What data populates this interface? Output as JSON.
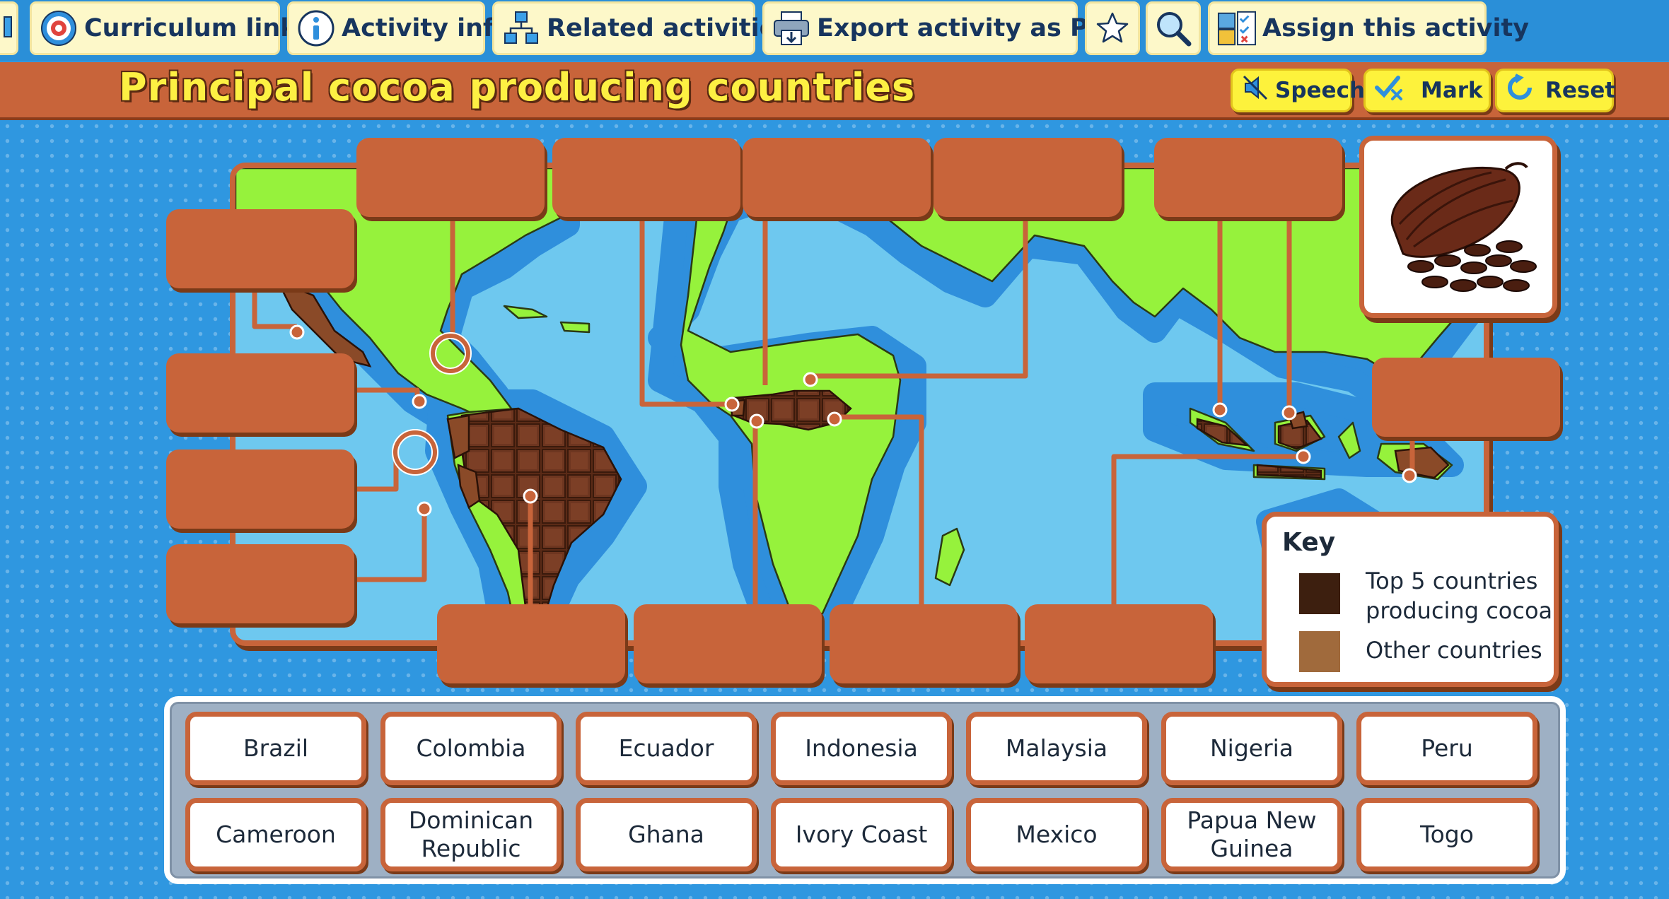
{
  "toolbar": {
    "curriculum_links": "Curriculum links",
    "activity_info": "Activity info",
    "related_activities": "Related activities",
    "export_pdf": "Export activity as PDF",
    "assign": "Assign this activity"
  },
  "title": "Principal cocoa producing countries",
  "actions": {
    "speech": "Speech",
    "mark": "Mark",
    "reset": "Reset"
  },
  "key": {
    "title": "Key",
    "items": [
      {
        "label": "Top 5 countries producing cocoa",
        "color": "#3d1f0f"
      },
      {
        "label": "Other countries",
        "color": "#a06a3c"
      }
    ]
  },
  "word_bank": [
    "Brazil",
    "Colombia",
    "Ecuador",
    "Indonesia",
    "Malaysia",
    "Nigeria",
    "Peru",
    "Cameroon",
    "Dominican Republic",
    "Ghana",
    "Ivory Coast",
    "Mexico",
    "Papua New Guinea",
    "Togo"
  ],
  "colors": {
    "accent": "#c8643a",
    "title_text": "#fdf043",
    "land": "#96f23c",
    "ocean": "#6ec8ef",
    "shelf": "#2f8fdc",
    "cocoa_dark": "#4a2414",
    "action_button": "#fdf23c"
  }
}
